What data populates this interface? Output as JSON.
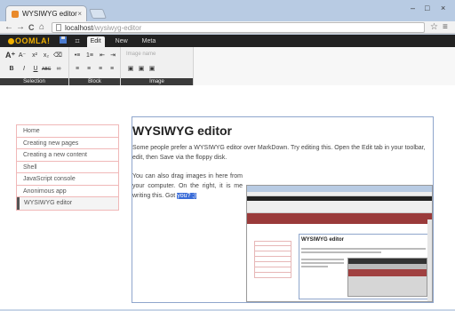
{
  "browser": {
    "tab_title": "WYSIWYG editor",
    "tab_close": "×",
    "url_host": "localhost",
    "url_path": "/wysiwyg-editor",
    "minimize": "–",
    "maximize": "□",
    "close": "×",
    "back": "←",
    "forward": "→",
    "reload": "C",
    "home": "⌂",
    "star": "☆",
    "menu": "≡"
  },
  "editor": {
    "logo": "OOMLA!",
    "save_icon": "💾",
    "grid_icon": "⌗",
    "tabs": [
      "Edit",
      "New",
      "Meta"
    ],
    "image_name_placeholder": "Image name",
    "groups": [
      "Selection",
      "Block",
      "Image"
    ],
    "buttons": {
      "font_increase": "A⁺",
      "font_decrease": "A⁻",
      "superscript": "x²",
      "subscript": "x₂",
      "clear_format": "⌫",
      "bold": "B",
      "italic": "I",
      "underline": "U",
      "strike": "ABC",
      "link": "∞",
      "unordered_list": "•≡",
      "ordered_list": "1≡",
      "outdent": "⇤",
      "indent": "⇥",
      "align_left": "≡",
      "align_center": "≡",
      "align_right": "≡",
      "justify": "≡",
      "image_left": "▣",
      "image_center": "▣",
      "image_right": "▣"
    }
  },
  "sidebar": {
    "items": [
      "Home",
      "Creating new pages",
      "Creating a new content",
      "Shell",
      "JavaScript console",
      "Anonimous app",
      "WYSIWYG editor"
    ]
  },
  "content": {
    "title": "WYSIWYG editor",
    "para1": "Some people prefer a WYSIWYG editor over MarkDown. Try editing this. Open the Edit tab in your toolbar, edit, then Save via the floppy disk.",
    "para2_start": "You can also drag images in here from your computer. On the right, it is me writing this. Got ",
    "para2_selected": "you? ;)",
    "shot_title": "WYSIWYG editor"
  }
}
